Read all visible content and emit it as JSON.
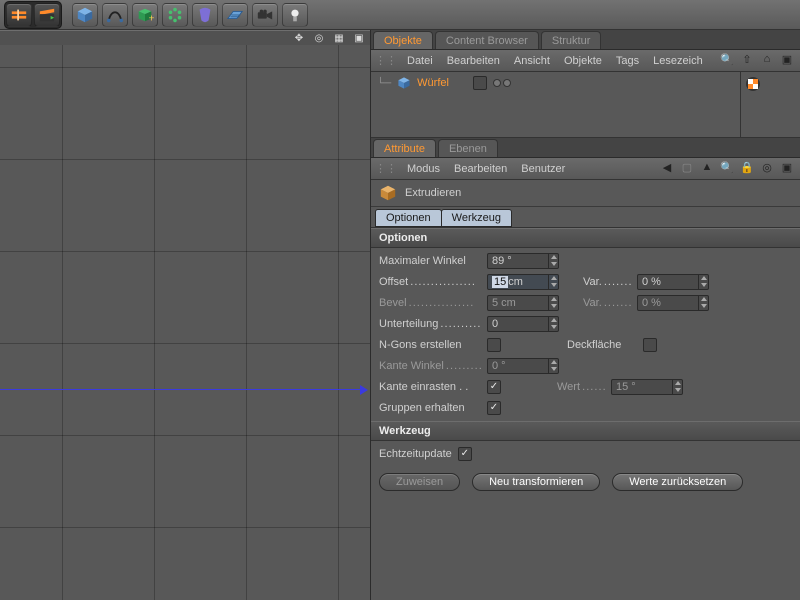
{
  "toolbar": {
    "group_dark": [
      {
        "name": "timeline-icon"
      },
      {
        "name": "clapper-icon"
      }
    ],
    "buttons": [
      {
        "name": "cube-primitive-icon"
      },
      {
        "name": "spline-pen-icon"
      },
      {
        "name": "generator-cube-icon"
      },
      {
        "name": "array-icon"
      },
      {
        "name": "deformer-icon"
      },
      {
        "name": "floor-plane-icon"
      },
      {
        "name": "camera-icon"
      },
      {
        "name": "light-icon"
      }
    ]
  },
  "viewport": {
    "corner_icons": [
      "move-icon",
      "target-icon",
      "grid-icon",
      "maximize-icon"
    ]
  },
  "objects_panel": {
    "tabs": [
      "Objekte",
      "Content Browser",
      "Struktur"
    ],
    "active_tab": 0,
    "menu": [
      "Datei",
      "Bearbeiten",
      "Ansicht",
      "Objekte",
      "Tags",
      "Lesezeich"
    ],
    "trail_icons": [
      "search-icon",
      "arrow-up-icon",
      "home-icon",
      "maximize-icon"
    ],
    "item": {
      "name": "Würfel"
    }
  },
  "attributes_panel": {
    "tabs": [
      "Attribute",
      "Ebenen"
    ],
    "active_tab": 0,
    "menu": [
      "Modus",
      "Bearbeiten",
      "Benutzer"
    ],
    "trail_icons": [
      "back-icon",
      "forward-icon",
      "up-icon",
      "search-icon",
      "lock-icon",
      "new-icon",
      "maximize-icon"
    ],
    "title": "Extrudieren",
    "sub_tabs": [
      "Optionen",
      "Werkzeug"
    ],
    "sections": {
      "optionen": {
        "label": "Optionen",
        "max_winkel": {
          "label": "Maximaler Winkel",
          "value": "89 °"
        },
        "offset": {
          "label": "Offset",
          "value_sel": "15",
          "value_unit": "cm",
          "var_label": "Var.",
          "var_value": "0 %"
        },
        "bevel": {
          "label": "Bevel",
          "value": "5 cm",
          "var_label": "Var.",
          "var_value": "0 %"
        },
        "unterteilung": {
          "label": "Unterteilung",
          "value": "0"
        },
        "ngons": {
          "label": "N-Gons erstellen",
          "checked": false,
          "deck_label": "Deckfläche",
          "deck_checked": false
        },
        "kante_winkel": {
          "label": "Kante Winkel",
          "value": "0 °"
        },
        "kante_einrasten": {
          "label": "Kante einrasten",
          "checked": true,
          "wert_label": "Wert",
          "wert_value": "15 °"
        },
        "gruppen": {
          "label": "Gruppen erhalten",
          "checked": true
        }
      },
      "werkzeug": {
        "label": "Werkzeug",
        "echtzeit": {
          "label": "Echtzeitupdate",
          "checked": true
        },
        "buttons": {
          "zuweisen": "Zuweisen",
          "neu": "Neu transformieren",
          "reset": "Werte zurücksetzen"
        }
      }
    }
  }
}
